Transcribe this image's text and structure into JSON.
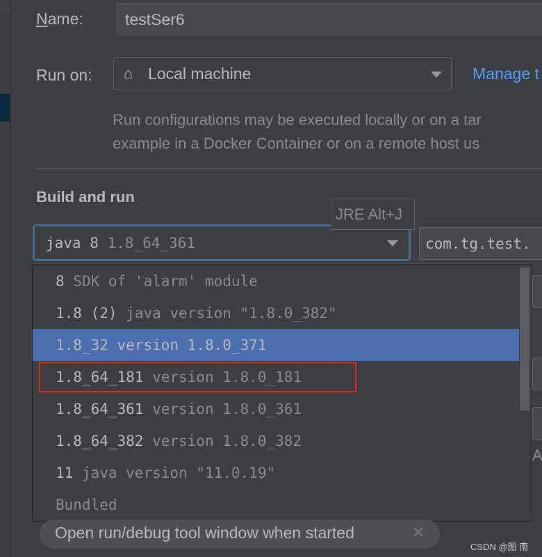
{
  "form": {
    "name_label": "Name:",
    "name_value": "testSer6",
    "run_on_label": "Run on:",
    "run_on_value": "Local machine",
    "run_on_icon": "home-icon",
    "manage_link": "Manage t",
    "description_line1": "Run configurations may be executed locally or on a tar",
    "description_line2": "example in a Docker Container or on a remote host us",
    "section_title": "Build and run",
    "jre_tooltip": "JRE Alt+J",
    "jre_selected_primary": "java 8",
    "jre_selected_secondary": "1.8_64_361",
    "main_class_value": "com.tg.test.",
    "partial_label": "AI"
  },
  "dropdown": {
    "items": [
      {
        "primary": "8",
        "secondary": "SDK of 'alarm' module",
        "selected": false
      },
      {
        "primary": "1.8 (2)",
        "secondary": "java version \"1.8.0_382\"",
        "selected": false
      },
      {
        "primary": "1.8_32",
        "secondary": "version 1.8.0_371",
        "selected": true
      },
      {
        "primary": "1.8_64_181",
        "secondary": "version 1.8.0_181",
        "selected": false,
        "highlighted_box": true
      },
      {
        "primary": "1.8_64_361",
        "secondary": "version 1.8.0_361",
        "selected": false
      },
      {
        "primary": "1.8_64_382",
        "secondary": "version 1.8.0_382",
        "selected": false
      },
      {
        "primary": "11",
        "secondary": "java version \"11.0.19\"",
        "selected": false
      },
      {
        "primary": "",
        "secondary": "Bundled",
        "selected": false
      }
    ]
  },
  "option_chip": {
    "label": "Open run/debug tool window when started",
    "close_icon": "close-icon"
  },
  "watermark": "CSDN @图 南",
  "colors": {
    "accent": "#4b6eaf",
    "link": "#589df6",
    "annotation": "#e0281e"
  }
}
